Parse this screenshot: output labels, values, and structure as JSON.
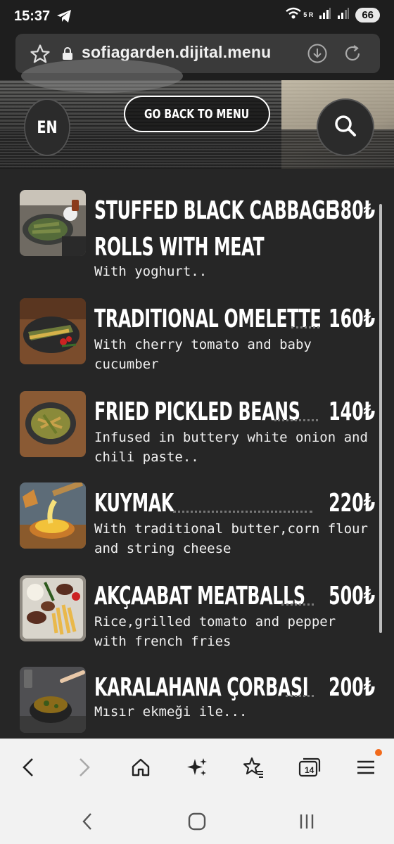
{
  "status_bar": {
    "time": "15:37",
    "network_label": "5 R",
    "battery": "66",
    "icons": [
      "telegram-icon",
      "wifi-icon",
      "signal-icon",
      "signal-icon"
    ]
  },
  "browser": {
    "url": "sofiagarden.dijital.menu",
    "tab_count": "14",
    "icons": [
      "star-icon",
      "lock-icon",
      "download-icon",
      "reload-icon"
    ]
  },
  "header": {
    "language": "EN",
    "back_label": "GO BACK TO MENU",
    "search_icon": "search-icon"
  },
  "menu_items": [
    {
      "name_line1": "STUFFED BLACK CABBAGE",
      "name_line2": "ROLLS WITH MEAT",
      "price": "380₺",
      "description": "With yoghurt.."
    },
    {
      "name": "TRADITIONAL OMELETTE",
      "price": "160₺",
      "description": "With cherry tomato and baby cucumber"
    },
    {
      "name": "FRIED PICKLED BEANS",
      "price": "140₺",
      "description": "Infused in buttery white onion and chili paste.."
    },
    {
      "name": "KUYMAK",
      "price": "220₺",
      "description": "With traditional butter,corn flour and string cheese"
    },
    {
      "name": "AKÇAABAT MEATBALLS",
      "price": "500₺",
      "description": "Rice,grilled tomato and pepper with french fries"
    },
    {
      "name": "KARALAHANA ÇORBASI",
      "price": "200₺",
      "description": "Mısır ekmeği ile..."
    }
  ],
  "bottom_toolbar": {
    "icons": [
      "back-arrow-icon",
      "forward-arrow-icon",
      "home-icon",
      "sparkle-icon",
      "bookmark-star-icon",
      "tabs-icon",
      "menu-icon"
    ]
  },
  "system_nav": {
    "icons": [
      "nav-back-icon",
      "nav-home-icon",
      "nav-recents-icon"
    ]
  },
  "colors": {
    "background": "#262626",
    "text": "#ffffff",
    "notification_dot": "#f26a1b"
  }
}
